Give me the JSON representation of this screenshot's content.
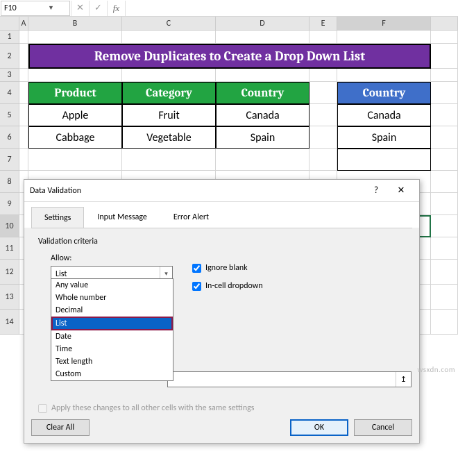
{
  "name_box": "F10",
  "fx_label": "fx",
  "columns": [
    "A",
    "B",
    "C",
    "D",
    "E",
    "F"
  ],
  "selected_col": "F",
  "rows": [
    "1",
    "2",
    "3",
    "4",
    "5",
    "6",
    "7",
    "8",
    "9",
    "10",
    "11",
    "12",
    "13",
    "14"
  ],
  "selected_row": "10",
  "title": "Remove Duplicates to Create a Drop Down List",
  "headers": {
    "b": "Product",
    "c": "Category",
    "d": "Country",
    "f": "Country"
  },
  "data": {
    "r5": {
      "b": "Apple",
      "c": "Fruit",
      "d": "Canada",
      "f": "Canada"
    },
    "r6": {
      "b": "Cabbage",
      "c": "Vegetable",
      "d": "Spain",
      "f": "Spain"
    }
  },
  "dialog": {
    "title": "Data Validation",
    "help": "?",
    "close": "✕",
    "tabs": {
      "settings": "Settings",
      "input": "Input Message",
      "error": "Error Alert"
    },
    "criteria": "Validation criteria",
    "allow_label": "Allow:",
    "allow_value": "List",
    "options": [
      "Any value",
      "Whole number",
      "Decimal",
      "List",
      "Date",
      "Time",
      "Text length",
      "Custom"
    ],
    "selected_option": "List",
    "ignore_blank": "Ignore blank",
    "incell": "In-cell dropdown",
    "apply": "Apply these changes to all other cells with the same settings",
    "clear": "Clear All",
    "ok": "OK",
    "cancel": "Cancel",
    "range_icon": "↥"
  },
  "watermark": "wsxdn.com"
}
